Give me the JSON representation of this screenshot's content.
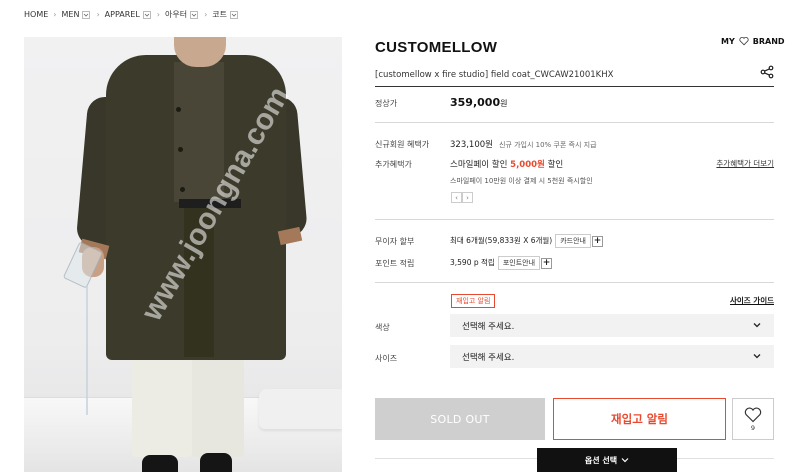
{
  "breadcrumb": [
    "HOME",
    "MEN",
    "APPAREL",
    "아우터",
    "코트"
  ],
  "product": {
    "brand": "CUSTOMELLOW",
    "name": "[customellow x fire studio] field coat_CWCAW21001KHX",
    "watermark": "www.joongna.com"
  },
  "header_links": {
    "my": "MY",
    "brand": "BRAND"
  },
  "price": {
    "label": "정상가",
    "value": "359,000",
    "unit": "원"
  },
  "benefits": {
    "member_label": "신규회원 혜택가",
    "member_value": "323,100원",
    "member_note": "신규 가입시 10% 쿠폰 즉시 지급",
    "extra_label": "추가혜택가",
    "extra_text_pre": "스마일페이 할인 ",
    "extra_text_red": "5,000원",
    "extra_text_post": " 할인",
    "extra_note": "스마일페이 10만원 이상 결제 시 5천원 즉시할인",
    "extra_link": "추가혜택가 더보기",
    "pager_prev": "‹",
    "pager_next": "›"
  },
  "installment": {
    "label": "무이자 할부",
    "value": "최대 6개월(59,833원 X 6개월)",
    "card_btn": "카드안내",
    "plus": "+"
  },
  "points": {
    "label": "포인트 적립",
    "value": "3,590 p 적립",
    "info_btn": "포인트안내",
    "plus": "+"
  },
  "options": {
    "restock_tag": "재입고 알림",
    "size_guide": "사이즈 가이드",
    "color_label": "색상",
    "color_placeholder": "선택해 주세요.",
    "size_label": "사이즈",
    "size_placeholder": "선택해 주세요."
  },
  "actions": {
    "soldout": "SOLD OUT",
    "restock": "재입고 알림",
    "wish_count": "9",
    "option_select": "옵션 선택"
  },
  "colors": {
    "accent": "#e84a2f",
    "soldout_bg": "#cfcfcf"
  }
}
